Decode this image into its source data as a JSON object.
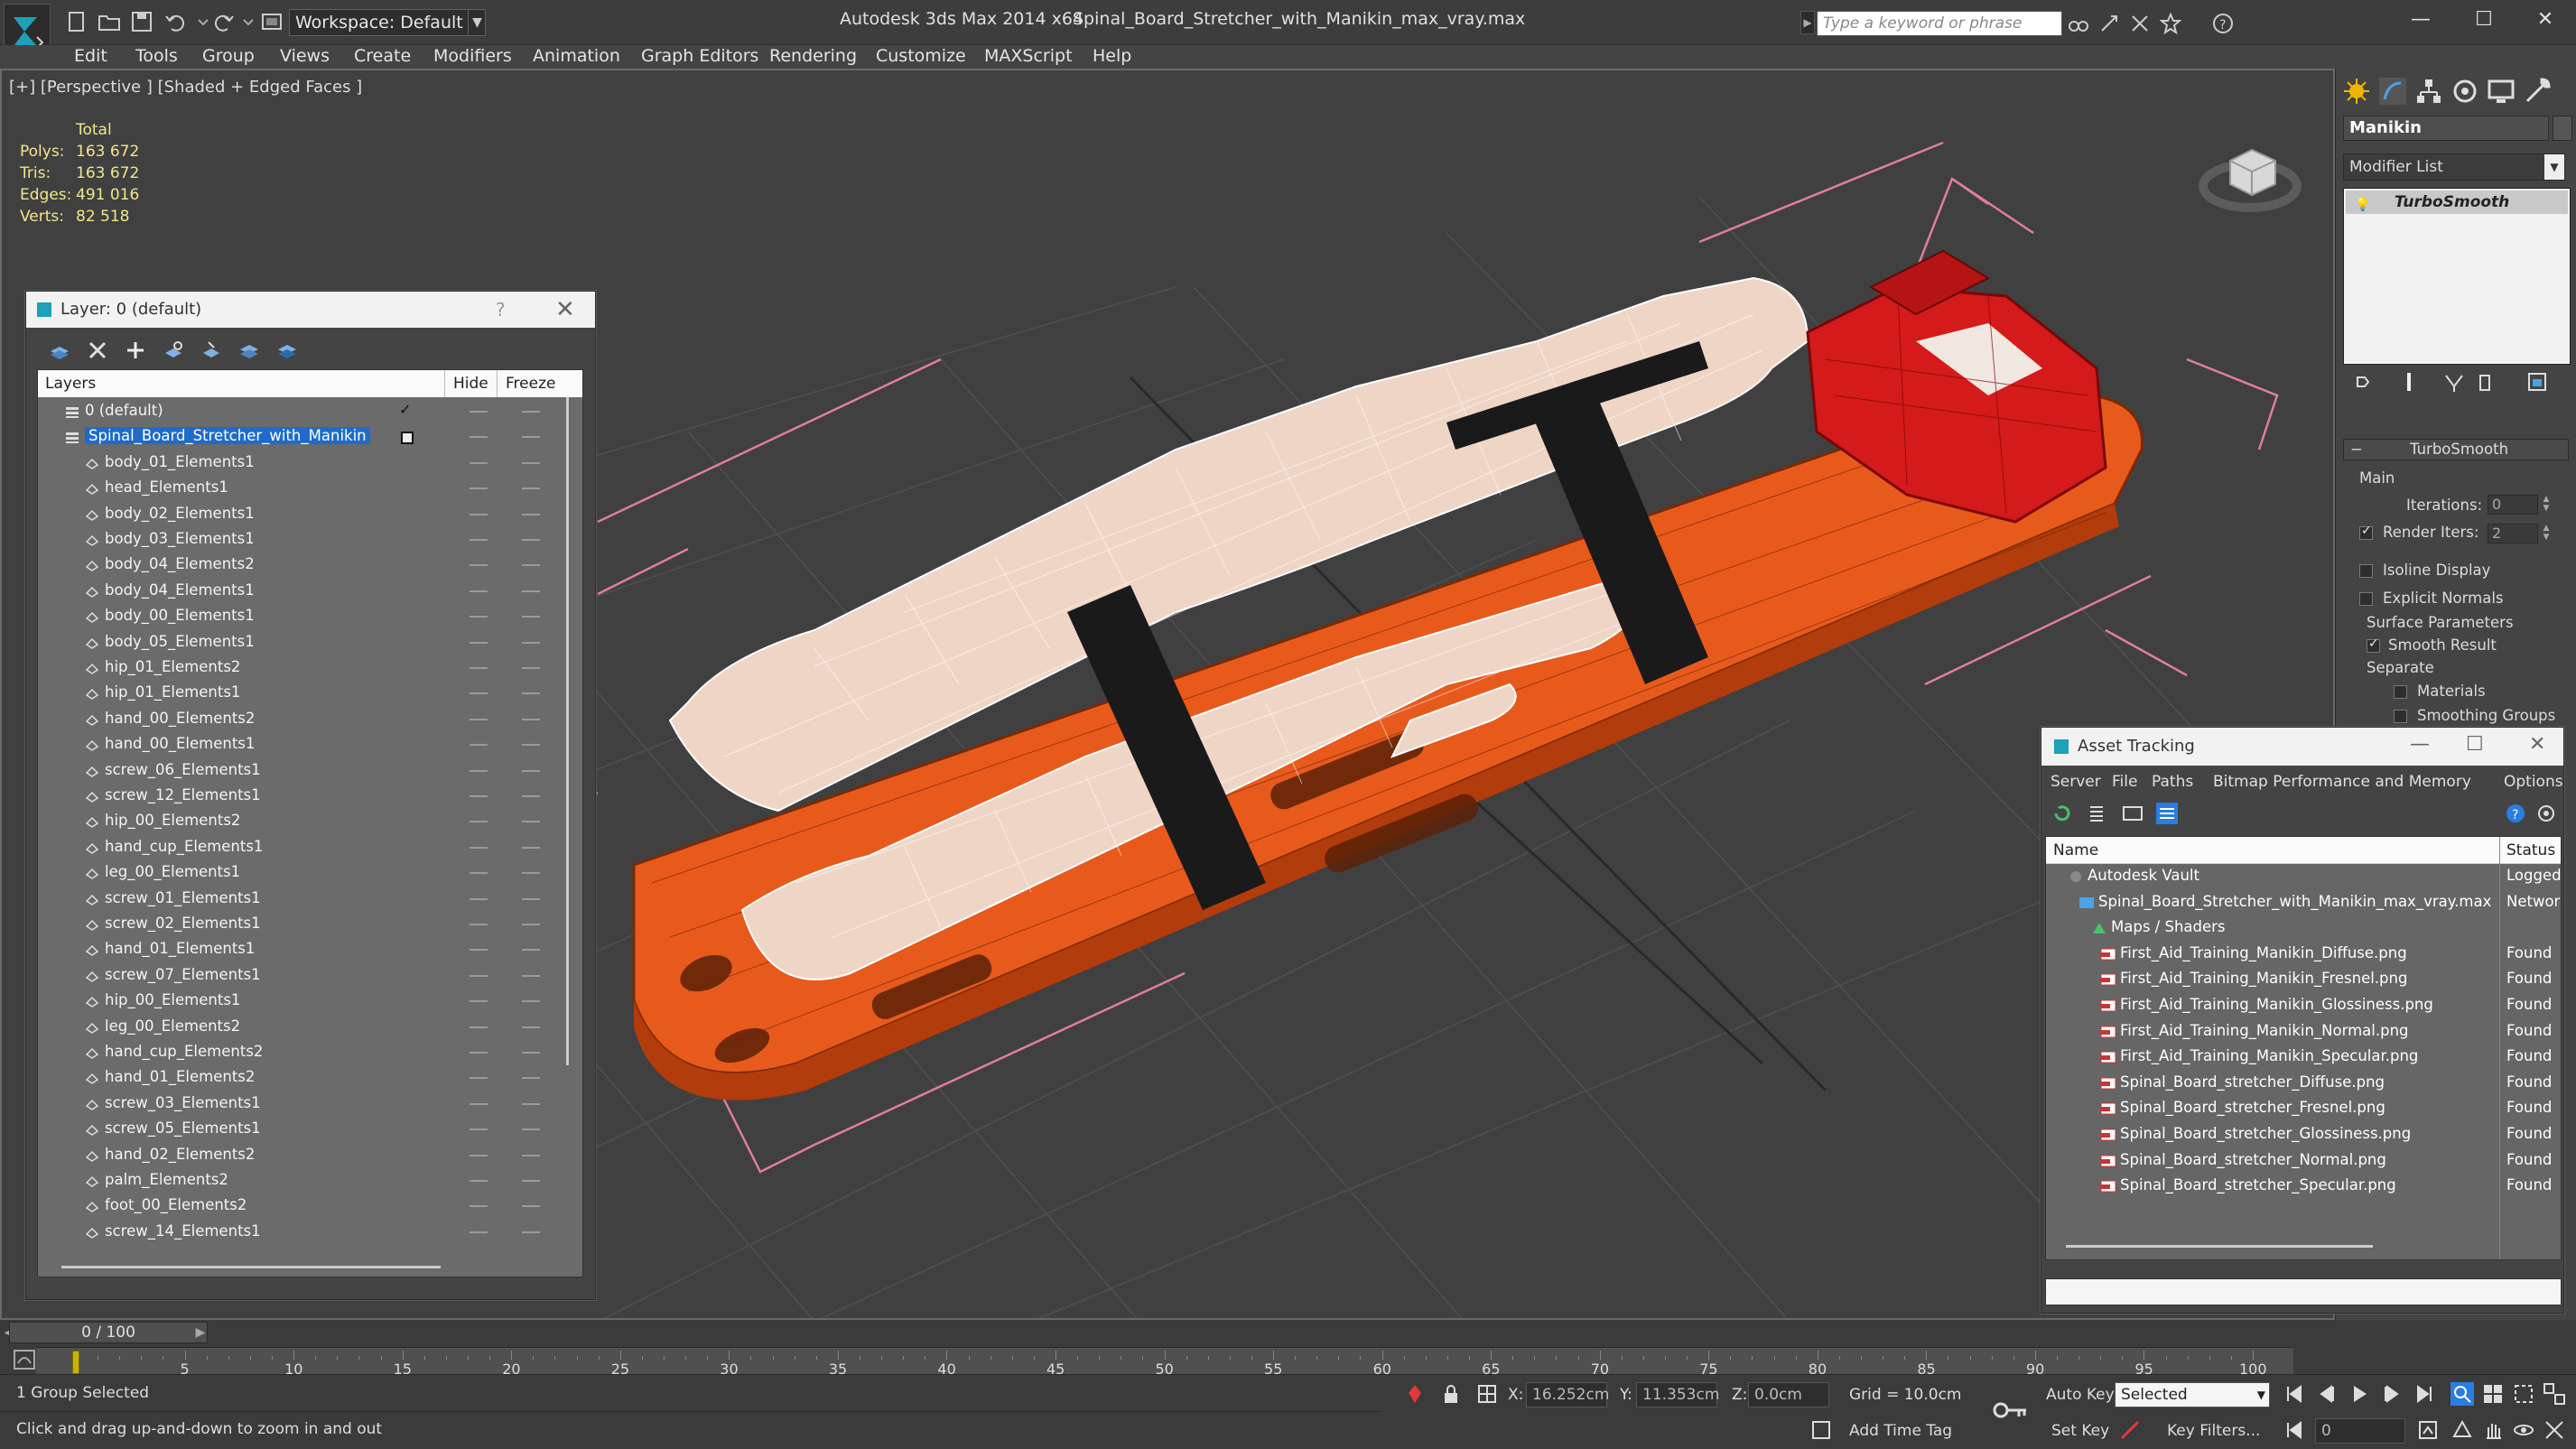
{
  "titlebar": {
    "workspace": "Workspace: Default",
    "app_title": "Autodesk 3ds Max  2014 x64",
    "file_title": "Spinal_Board_Stretcher_with_Manikin_max_vray.max",
    "search_placeholder": "Type a keyword or phrase"
  },
  "menu": [
    "Edit",
    "Tools",
    "Group",
    "Views",
    "Create",
    "Modifiers",
    "Animation",
    "Graph Editors",
    "Rendering",
    "Customize",
    "MAXScript",
    "Help"
  ],
  "viewport": {
    "label": "[+] [Perspective ] [Shaded + Edged Faces ]",
    "stats": {
      "header": "Total",
      "rows": [
        {
          "label": "Polys:",
          "value": "163 672"
        },
        {
          "label": "Tris:",
          "value": "163 672"
        },
        {
          "label": "Edges:",
          "value": "491 016"
        },
        {
          "label": "Verts:",
          "value": "82 518"
        }
      ]
    }
  },
  "layer_dialog": {
    "title": "Layer: 0 (default)",
    "help": "?",
    "columns": {
      "layers": "Layers",
      "hide": "Hide",
      "freeze": "Freeze"
    },
    "rows": [
      {
        "name": "0 (default)",
        "level": 0,
        "current": true
      },
      {
        "name": "Spinal_Board_Stretcher_with_Manikin",
        "level": 0,
        "selected": true
      },
      {
        "name": "body_01_Elements1",
        "level": 1
      },
      {
        "name": "head_Elements1",
        "level": 1
      },
      {
        "name": "body_02_Elements1",
        "level": 1
      },
      {
        "name": "body_03_Elements1",
        "level": 1
      },
      {
        "name": "body_04_Elements2",
        "level": 1
      },
      {
        "name": "body_04_Elements1",
        "level": 1
      },
      {
        "name": "body_00_Elements1",
        "level": 1
      },
      {
        "name": "body_05_Elements1",
        "level": 1
      },
      {
        "name": "hip_01_Elements2",
        "level": 1
      },
      {
        "name": "hip_01_Elements1",
        "level": 1
      },
      {
        "name": "hand_00_Elements2",
        "level": 1
      },
      {
        "name": "hand_00_Elements1",
        "level": 1
      },
      {
        "name": "screw_06_Elements1",
        "level": 1
      },
      {
        "name": "screw_12_Elements1",
        "level": 1
      },
      {
        "name": "hip_00_Elements2",
        "level": 1
      },
      {
        "name": "hand_cup_Elements1",
        "level": 1
      },
      {
        "name": "leg_00_Elements1",
        "level": 1
      },
      {
        "name": "screw_01_Elements1",
        "level": 1
      },
      {
        "name": "screw_02_Elements1",
        "level": 1
      },
      {
        "name": "hand_01_Elements1",
        "level": 1
      },
      {
        "name": "screw_07_Elements1",
        "level": 1
      },
      {
        "name": "hip_00_Elements1",
        "level": 1
      },
      {
        "name": "leg_00_Elements2",
        "level": 1
      },
      {
        "name": "hand_cup_Elements2",
        "level": 1
      },
      {
        "name": "hand_01_Elements2",
        "level": 1
      },
      {
        "name": "screw_03_Elements1",
        "level": 1
      },
      {
        "name": "screw_05_Elements1",
        "level": 1
      },
      {
        "name": "hand_02_Elements2",
        "level": 1
      },
      {
        "name": "palm_Elements2",
        "level": 1
      },
      {
        "name": "foot_00_Elements2",
        "level": 1
      },
      {
        "name": "screw_14_Elements1",
        "level": 1
      }
    ]
  },
  "command_panel": {
    "object_name": "Manikin",
    "modifier_list": "Modifier List",
    "stack_item": "TurboSmooth",
    "rollout_title": "TurboSmooth",
    "main_label": "Main",
    "iterations_label": "Iterations:",
    "iterations_value": "0",
    "render_iters_label": "Render Iters:",
    "render_iters_value": "2",
    "isoline_label": "Isoline Display",
    "explicit_normals_label": "Explicit Normals",
    "surface_params_label": "Surface Parameters",
    "smooth_result_label": "Smooth Result",
    "separate_label": "Separate",
    "materials_label": "Materials",
    "smoothing_groups_label": "Smoothing Groups"
  },
  "asset_dialog": {
    "title": "Asset Tracking",
    "menu": [
      "Server",
      "File",
      "Paths",
      "Bitmap Performance and Memory",
      "Options"
    ],
    "columns": {
      "name": "Name",
      "status": "Status"
    },
    "rows": [
      {
        "name": "Autodesk Vault",
        "status": "Logged",
        "level": 0,
        "icon": "vault-icon"
      },
      {
        "name": "Spinal_Board_Stretcher_with_Manikin_max_vray.max",
        "status": "Networ",
        "level": 1,
        "icon": "max-file-icon"
      },
      {
        "name": "Maps / Shaders",
        "status": "",
        "level": 2,
        "icon": "maps-icon"
      },
      {
        "name": "First_Aid_Training_Manikin_Diffuse.png",
        "status": "Found",
        "level": 3,
        "icon": "png-icon"
      },
      {
        "name": "First_Aid_Training_Manikin_Fresnel.png",
        "status": "Found",
        "level": 3,
        "icon": "png-icon"
      },
      {
        "name": "First_Aid_Training_Manikin_Glossiness.png",
        "status": "Found",
        "level": 3,
        "icon": "png-icon"
      },
      {
        "name": "First_Aid_Training_Manikin_Normal.png",
        "status": "Found",
        "level": 3,
        "icon": "png-icon"
      },
      {
        "name": "First_Aid_Training_Manikin_Specular.png",
        "status": "Found",
        "level": 3,
        "icon": "png-icon"
      },
      {
        "name": "Spinal_Board_stretcher_Diffuse.png",
        "status": "Found",
        "level": 3,
        "icon": "png-icon"
      },
      {
        "name": "Spinal_Board_stretcher_Fresnel.png",
        "status": "Found",
        "level": 3,
        "icon": "png-icon"
      },
      {
        "name": "Spinal_Board_stretcher_Glossiness.png",
        "status": "Found",
        "level": 3,
        "icon": "png-icon"
      },
      {
        "name": "Spinal_Board_stretcher_Normal.png",
        "status": "Found",
        "level": 3,
        "icon": "png-icon"
      },
      {
        "name": "Spinal_Board_stretcher_Specular.png",
        "status": "Found",
        "level": 3,
        "icon": "png-icon"
      }
    ]
  },
  "timeline": {
    "slider_text": "0 / 100",
    "ticks": [
      "5",
      "10",
      "15",
      "20",
      "25",
      "30",
      "35",
      "40",
      "45",
      "50",
      "55",
      "60",
      "65",
      "70",
      "75",
      "80",
      "85",
      "90",
      "95",
      "100"
    ]
  },
  "statusbar": {
    "selection": "1 Group Selected",
    "prompt": "Click and drag up-and-down to zoom in and out",
    "x_label": "X:",
    "x_value": "16.252cm",
    "y_label": "Y:",
    "y_value": "11.353cm",
    "z_label": "Z:",
    "z_value": "0.0cm",
    "grid": "Grid = 10.0cm",
    "auto_key": "Auto Key",
    "set_key": "Set Key",
    "selected_dropdown": "Selected",
    "key_filters": "Key Filters...",
    "add_time_tag": "Add Time Tag",
    "frame_value": "0"
  },
  "colors": {
    "accent_blue": "#1f6bcb",
    "stats_yellow": "#f0e68c",
    "stretcher_orange": "#e85a1c",
    "headblock_red": "#d41a1a",
    "strap_black": "#1a1a1a"
  }
}
